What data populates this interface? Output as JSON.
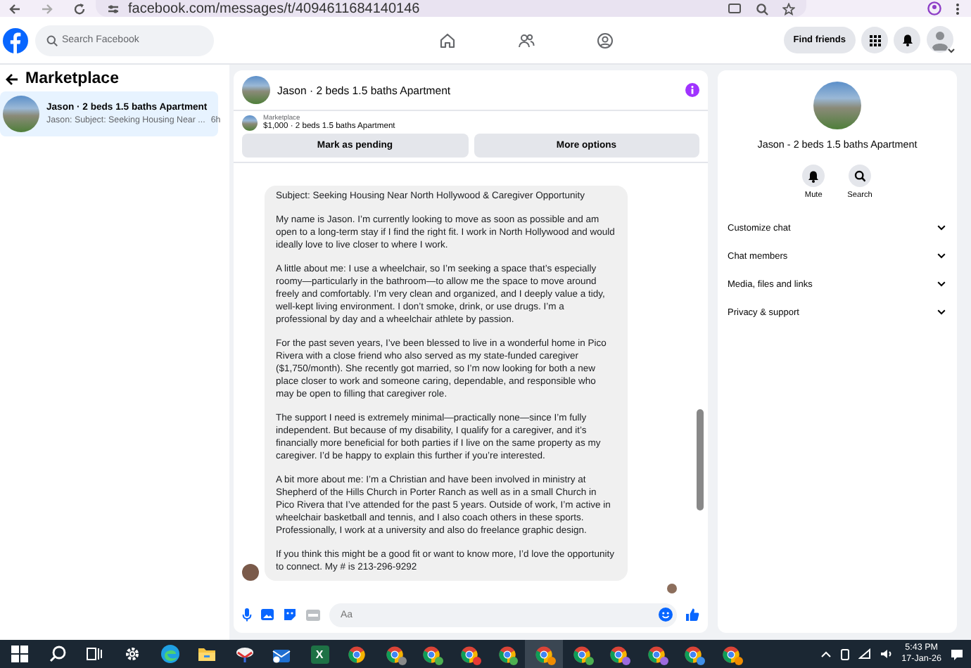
{
  "browser": {
    "url": "facebook.com/messages/t/4094611684140146"
  },
  "header": {
    "search": {
      "placeholder": "Search Facebook"
    },
    "find_friends": "Find friends"
  },
  "sidebar": {
    "title": "Marketplace",
    "items": [
      {
        "title": "Jason · 2 beds 1.5 baths Apartment",
        "preview": "Jason: Subject: Seeking Housing Near ...",
        "time": "6h",
        "selected": true
      }
    ]
  },
  "chat": {
    "title": "Jason · 2 beds 1.5 baths Apartment",
    "listing": {
      "label": "Marketplace",
      "summary": "$1,000 · 2 beds 1.5 baths Apartment"
    },
    "actions": [
      "Mark as pending",
      "More options"
    ],
    "message": {
      "paragraphs": [
        "Subject: Seeking Housing Near North Hollywood & Caregiver Opportunity",
        "My name is Jason. I’m currently looking to move as soon as possible and am open to a long-term stay if I find the right fit. I work in North Hollywood and would ideally love to live closer to where I work.",
        "A little about me: I use a wheelchair, so I’m seeking a space that’s especially roomy—particularly in the bathroom—to allow me the space to move around freely and comfortably. I’m very clean and organized, and I deeply value a tidy, well-kept living environment. I don’t smoke, drink, or use drugs. I’m a professional by day and a wheelchair athlete by passion.",
        "For the past seven years, I’ve been blessed to live in a wonderful home in Pico Rivera with a close friend who also served as my state-funded caregiver ($1,750/month). She recently got married, so I’m now looking for both a new place closer to work and someone caring, dependable, and responsible who may be open to filling that caregiver role.",
        "The support I need is extremely minimal—practically none—since I’m fully independent. But because of my disability, I qualify for a caregiver, and it’s financially more beneficial for both parties if I live on the same property as my caregiver. I’d be happy to explain this further if you’re interested.",
        "A bit more about me: I’m a Christian and have been involved in ministry at Shepherd of the Hills Church in Porter Ranch as well as in a small Church in Pico Rivera that I’ve attended for the past 5 years. Outside of work, I’m active in wheelchair basketball and tennis, and I also coach others in these sports. Professionally, I work at a university and also do freelance graphic design.",
        "If you think this might be a good fit or want to know more, I’d love the opportunity to connect. My # is 213-296-9292"
      ]
    },
    "composer": {
      "placeholder": "Aa"
    }
  },
  "info": {
    "name": "Jason - 2 beds 1.5 baths Apartment",
    "actions": [
      "Mute",
      "Search"
    ],
    "sections": [
      "Customize chat",
      "Chat members",
      "Media, files and links",
      "Privacy & support"
    ]
  },
  "taskbar": {
    "apps": [
      {
        "kind": "start",
        "selected": false
      },
      {
        "kind": "search",
        "selected": false
      },
      {
        "kind": "taskview",
        "selected": false
      },
      {
        "kind": "settings",
        "selected": false
      },
      {
        "kind": "edge",
        "selected": false
      },
      {
        "kind": "explorer",
        "selected": false
      },
      {
        "kind": "app",
        "selected": false
      },
      {
        "kind": "mail",
        "selected": false
      },
      {
        "kind": "excel",
        "glyph": "X",
        "selected": false
      },
      {
        "kind": "chrome",
        "selected": false
      },
      {
        "kind": "chrome",
        "color": "#8a8a8a",
        "selected": false
      },
      {
        "kind": "chrome",
        "color": "#4caf50",
        "selected": false
      },
      {
        "kind": "chrome",
        "color": "#e53935",
        "selected": false
      },
      {
        "kind": "chrome",
        "color": "#4caf50",
        "selected": false
      },
      {
        "kind": "chrome",
        "color": "#f08c00",
        "selected": true
      },
      {
        "kind": "chrome",
        "color": "#4caf50",
        "selected": false
      },
      {
        "kind": "chrome",
        "color": "#9c6ade",
        "selected": false
      },
      {
        "kind": "chrome",
        "color": "#9c6ade",
        "selected": false
      },
      {
        "kind": "chrome",
        "color": "#3f8ee8",
        "selected": false
      },
      {
        "kind": "chrome",
        "color": "#f08c00",
        "selected": false
      }
    ],
    "time": "5:43 PM",
    "date": "17-Jan-26"
  }
}
